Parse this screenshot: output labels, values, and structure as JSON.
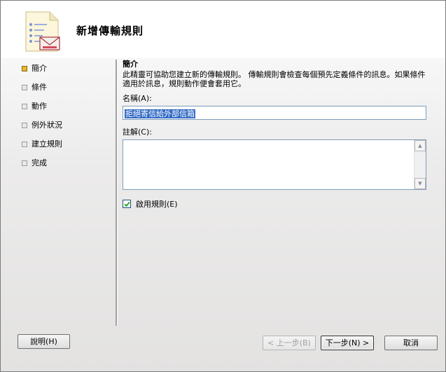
{
  "wizard": {
    "title": "新增傳輸規則"
  },
  "steps": [
    {
      "label": "簡介",
      "active": true
    },
    {
      "label": "條件",
      "active": false
    },
    {
      "label": "動作",
      "active": false
    },
    {
      "label": "例外狀況",
      "active": false
    },
    {
      "label": "建立規則",
      "active": false
    },
    {
      "label": "完成",
      "active": false
    }
  ],
  "intro": {
    "section_title": "簡介",
    "description": "此精靈可協助您建立新的傳輸規則。 傳輸規則會檢查每個預先定義條件的訊息。如果條件適用於訊息，規則動作便會套用它。",
    "name_label": "名稱(A):",
    "name_value": "拒絕寄信給外部信箱",
    "comment_label": "註解(C):",
    "comment_value": "",
    "enable_label": "啟用規則(E)",
    "enable_checked": true
  },
  "buttons": {
    "help": "說明(H)",
    "back": "< 上一步(B)",
    "next": "下一步(N) >",
    "cancel": "取消"
  },
  "icons": {
    "wizard": "document-mail-icon",
    "scroll_up": "scroll-up-arrow-icon",
    "scroll_down": "scroll-down-arrow-icon"
  },
  "colors": {
    "active_step": "#e8b72c",
    "selection": "#316ac5"
  }
}
